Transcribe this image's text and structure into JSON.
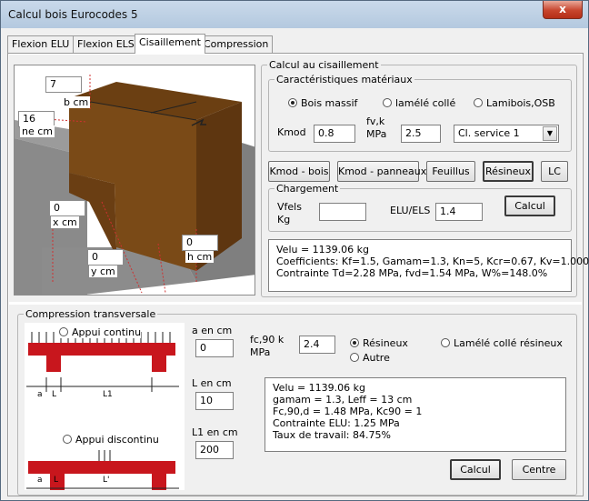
{
  "window": {
    "title": "Calcul bois Eurocodes 5",
    "close_label": "x"
  },
  "tabs": [
    {
      "label": "Flexion ELU"
    },
    {
      "label": "Flexion ELS"
    },
    {
      "label": "Cisaillement"
    },
    {
      "label": "Compression"
    }
  ],
  "shear_figure": {
    "b": {
      "value": "7",
      "label": "b cm"
    },
    "h_top": {
      "value": "16",
      "label": "ne cm"
    },
    "x": {
      "value": "0",
      "label": "x cm"
    },
    "y": {
      "value": "0",
      "label": "y cm"
    },
    "h": {
      "value": "0",
      "label": "h cm"
    }
  },
  "calc": {
    "title": "Calcul au cisaillement",
    "materials": {
      "title": "Caractéristiques matériaux",
      "options": [
        "Bois massif",
        "lamélé collé",
        "Lamibois,OSB"
      ],
      "kmod_label": "Kmod",
      "kmod_value": "0.8",
      "fvk_label1": "fv,k",
      "fvk_label2": "MPa",
      "fvk_value": "2.5",
      "service_class": "Cl. service 1"
    },
    "buttons": [
      "Kmod - bois",
      "Kmod - panneaux",
      "Feuillus",
      "Résineux",
      "LC"
    ],
    "loading": {
      "title": "Chargement",
      "vfels_label1": "Vfels",
      "vfels_label2": "Kg",
      "vfels_value": "",
      "eluels_label": "ELU/ELS",
      "eluels_value": "1.4",
      "calc_button": "Calcul"
    },
    "results": [
      "Velu = 1139.06 kg",
      "Coefficients: Kf=1.5, Gamam=1.3, Kn=5, Kcr=0.67, Kv=1.000",
      "Contrainte Td=2.28 MPa, fvd=1.54 MPa, W%=148.0%"
    ]
  },
  "compression": {
    "title": "Compression transversale",
    "support_continuous": "Appui continu",
    "support_discontinuous": "Appui discontinu",
    "diagram_labels": {
      "a": "a",
      "l": "L",
      "l1": "L1",
      "l1b": "L'"
    },
    "a_label": "a en cm",
    "a_value": "0",
    "l_label": "L en cm",
    "l_value": "10",
    "l1_label": "L1 en cm",
    "l1_value": "200",
    "fc90_label1": "fc,90 k",
    "fc90_label2": "MPa",
    "fc90_value": "2.4",
    "wood_options": [
      "Résineux",
      "Lamélé collé résineux",
      "Autre"
    ],
    "results": [
      "Velu = 1139.06 kg",
      "gamam = 1.3, Leff = 13 cm",
      "Fc,90,d = 1.48 MPa, Kc90 = 1",
      "Contrainte ELU: 1.25 MPa",
      "Taux de travail: 84.75%"
    ],
    "calc_button": "Calcul",
    "center_button": "Centre"
  },
  "colors": {
    "wood": "#7a4a17",
    "wood_dark": "#5e3610",
    "concrete": "#8c8c8c",
    "beam_red": "#c8161d"
  }
}
